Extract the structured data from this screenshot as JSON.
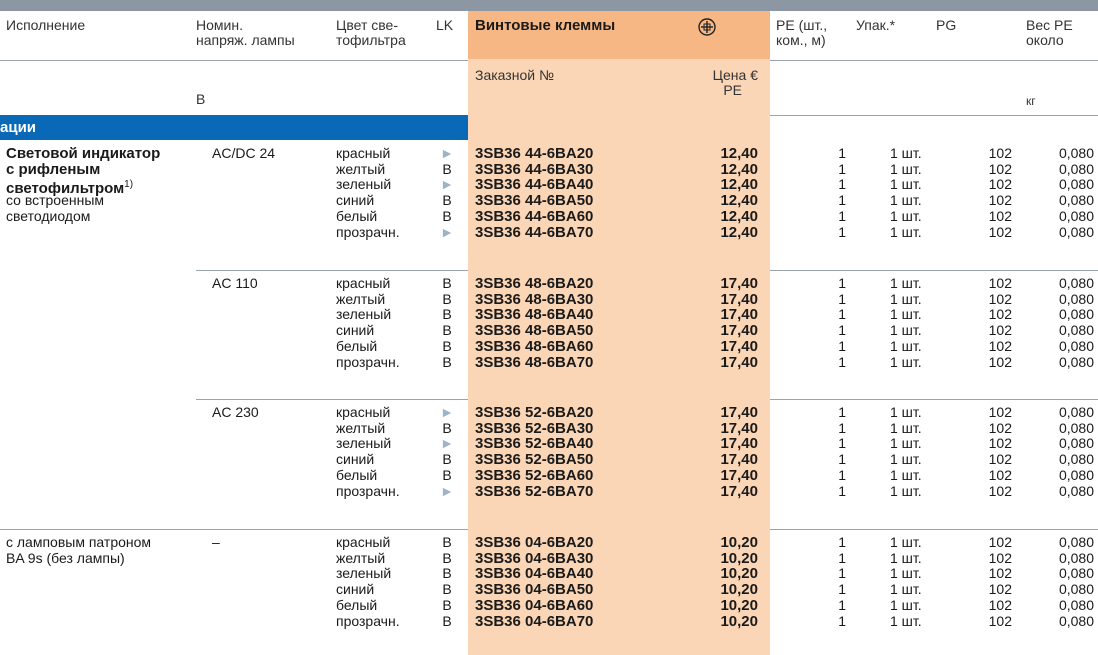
{
  "header": {
    "execution": "Исполнение",
    "voltage_l1": "Номин.",
    "voltage_l2": "напряж. лампы",
    "filter_l1": "Цвет све-",
    "filter_l2": "тофильтра",
    "lk": "LK",
    "screw": "Винтовые клеммы",
    "screw_icon": "screw-terminal-icon",
    "pe_l1": "PE (шт.,",
    "pe_l2": "ком., м)",
    "pack": "Упак.*",
    "pg": "PG",
    "weight_l1": "Вес PE",
    "weight_l2": "около",
    "order_no": "Заказной №",
    "price_l1": "Цена €",
    "price_l2": "PE",
    "unit_v": "B",
    "unit_kg": "кг"
  },
  "section": "ации",
  "blocks": [
    {
      "desc_bold": [
        "Световой индикатор",
        "с рифленым",
        "светофильтром"
      ],
      "desc_sup": "1)",
      "desc_plain": [
        "со встроенным",
        "светодиодом"
      ],
      "voltage": "AC/DC 24",
      "rows": [
        {
          "color": "красный",
          "lk": "►",
          "code": "3SB36 44-6BA20",
          "price": "12,40",
          "pe": "1",
          "pack": "1 шт.",
          "pg": "102",
          "weight": "0,080"
        },
        {
          "color": "желтый",
          "lk": "B",
          "code": "3SB36 44-6BA30",
          "price": "12,40",
          "pe": "1",
          "pack": "1 шт.",
          "pg": "102",
          "weight": "0,080"
        },
        {
          "color": "зеленый",
          "lk": "►",
          "code": "3SB36 44-6BA40",
          "price": "12,40",
          "pe": "1",
          "pack": "1 шт.",
          "pg": "102",
          "weight": "0,080"
        },
        {
          "color": "синий",
          "lk": "B",
          "code": "3SB36 44-6BA50",
          "price": "12,40",
          "pe": "1",
          "pack": "1 шт.",
          "pg": "102",
          "weight": "0,080"
        },
        {
          "color": "белый",
          "lk": "B",
          "code": "3SB36 44-6BA60",
          "price": "12,40",
          "pe": "1",
          "pack": "1 шт.",
          "pg": "102",
          "weight": "0,080"
        },
        {
          "color": "прозрачн.",
          "lk": "►",
          "code": "3SB36 44-6BA70",
          "price": "12,40",
          "pe": "1",
          "pack": "1 шт.",
          "pg": "102",
          "weight": "0,080"
        }
      ]
    },
    {
      "voltage": "AC 110",
      "rows": [
        {
          "color": "красный",
          "lk": "B",
          "code": "3SB36 48-6BA20",
          "price": "17,40",
          "pe": "1",
          "pack": "1 шт.",
          "pg": "102",
          "weight": "0,080"
        },
        {
          "color": "желтый",
          "lk": "B",
          "code": "3SB36 48-6BA30",
          "price": "17,40",
          "pe": "1",
          "pack": "1 шт.",
          "pg": "102",
          "weight": "0,080"
        },
        {
          "color": "зеленый",
          "lk": "B",
          "code": "3SB36 48-6BA40",
          "price": "17,40",
          "pe": "1",
          "pack": "1 шт.",
          "pg": "102",
          "weight": "0,080"
        },
        {
          "color": "синий",
          "lk": "B",
          "code": "3SB36 48-6BA50",
          "price": "17,40",
          "pe": "1",
          "pack": "1 шт.",
          "pg": "102",
          "weight": "0,080"
        },
        {
          "color": "белый",
          "lk": "B",
          "code": "3SB36 48-6BA60",
          "price": "17,40",
          "pe": "1",
          "pack": "1 шт.",
          "pg": "102",
          "weight": "0,080"
        },
        {
          "color": "прозрачн.",
          "lk": "B",
          "code": "3SB36 48-6BA70",
          "price": "17,40",
          "pe": "1",
          "pack": "1 шт.",
          "pg": "102",
          "weight": "0,080"
        }
      ]
    },
    {
      "voltage": "AC 230",
      "rows": [
        {
          "color": "красный",
          "lk": "►",
          "code": "3SB36 52-6BA20",
          "price": "17,40",
          "pe": "1",
          "pack": "1 шт.",
          "pg": "102",
          "weight": "0,080"
        },
        {
          "color": "желтый",
          "lk": "B",
          "code": "3SB36 52-6BA30",
          "price": "17,40",
          "pe": "1",
          "pack": "1 шт.",
          "pg": "102",
          "weight": "0,080"
        },
        {
          "color": "зеленый",
          "lk": "►",
          "code": "3SB36 52-6BA40",
          "price": "17,40",
          "pe": "1",
          "pack": "1 шт.",
          "pg": "102",
          "weight": "0,080"
        },
        {
          "color": "синий",
          "lk": "B",
          "code": "3SB36 52-6BA50",
          "price": "17,40",
          "pe": "1",
          "pack": "1 шт.",
          "pg": "102",
          "weight": "0,080"
        },
        {
          "color": "белый",
          "lk": "B",
          "code": "3SB36 52-6BA60",
          "price": "17,40",
          "pe": "1",
          "pack": "1 шт.",
          "pg": "102",
          "weight": "0,080"
        },
        {
          "color": "прозрачн.",
          "lk": "►",
          "code": "3SB36 52-6BA70",
          "price": "17,40",
          "pe": "1",
          "pack": "1 шт.",
          "pg": "102",
          "weight": "0,080"
        }
      ]
    },
    {
      "desc_plain": [
        "с ламповым патроном",
        "BA 9s (без лампы)"
      ],
      "voltage": "–",
      "rows": [
        {
          "color": "красный",
          "lk": "B",
          "code": "3SB36 04-6BA20",
          "price": "10,20",
          "pe": "1",
          "pack": "1 шт.",
          "pg": "102",
          "weight": "0,080"
        },
        {
          "color": "желтый",
          "lk": "B",
          "code": "3SB36 04-6BA30",
          "price": "10,20",
          "pe": "1",
          "pack": "1 шт.",
          "pg": "102",
          "weight": "0,080"
        },
        {
          "color": "зеленый",
          "lk": "B",
          "code": "3SB36 04-6BA40",
          "price": "10,20",
          "pe": "1",
          "pack": "1 шт.",
          "pg": "102",
          "weight": "0,080"
        },
        {
          "color": "синий",
          "lk": "B",
          "code": "3SB36 04-6BA50",
          "price": "10,20",
          "pe": "1",
          "pack": "1 шт.",
          "pg": "102",
          "weight": "0,080"
        },
        {
          "color": "белый",
          "lk": "B",
          "code": "3SB36 04-6BA60",
          "price": "10,20",
          "pe": "1",
          "pack": "1 шт.",
          "pg": "102",
          "weight": "0,080"
        },
        {
          "color": "прозрачн.",
          "lk": "B",
          "code": "3SB36 04-6BA70",
          "price": "10,20",
          "pe": "1",
          "pack": "1 шт.",
          "pg": "102",
          "weight": "0,080"
        }
      ]
    }
  ],
  "colors": {
    "blue_band": "#0a69b7",
    "orange_light": "#fbd6b6",
    "orange_header": "#f7b785",
    "top_rule": "#8c97a3"
  }
}
